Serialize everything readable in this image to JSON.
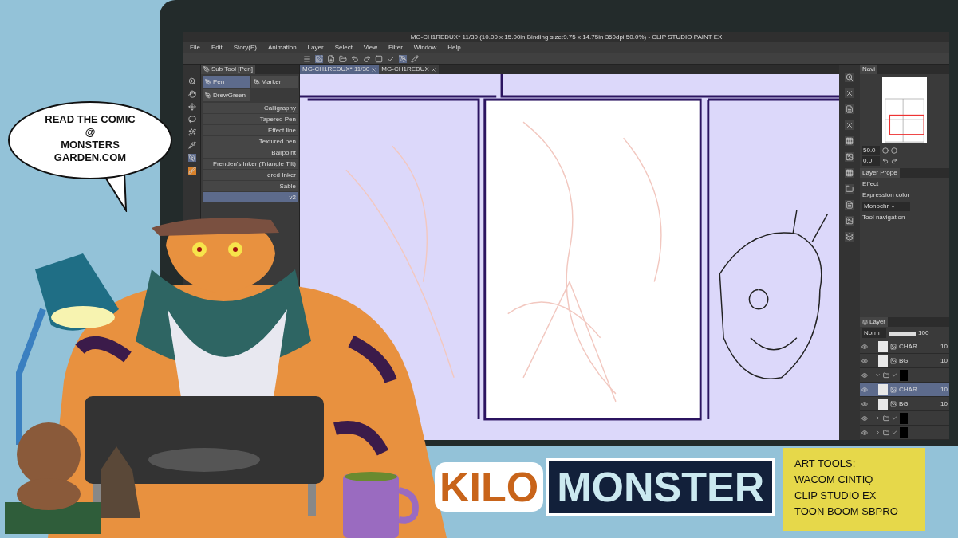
{
  "speech_bubble": {
    "lines": [
      "READ THE COMIC",
      "@",
      "MONSTERS",
      "GARDEN.COM"
    ]
  },
  "app": {
    "title": "MG-CH1REDUX* 11/30 (10.00 x 15.00in Binding size:9.75 x 14.75in 350dpi 50.0%)  - CLIP STUDIO PAINT EX",
    "menu": [
      "File",
      "Edit",
      "Story(P)",
      "Animation",
      "Layer",
      "Select",
      "View",
      "Filter",
      "Window",
      "Help"
    ],
    "doc_tabs": [
      {
        "label": "MG-CH1REDUX* 11/30",
        "selected": true
      },
      {
        "label": "MG-CH1REDUX",
        "selected": false
      }
    ],
    "sub_tool": {
      "tab": "Sub Tool [Pen]",
      "groups": [
        {
          "label": "Pen",
          "selected": true
        },
        {
          "label": "Marker",
          "selected": false
        },
        {
          "label": "DrewGreen",
          "selected": false
        }
      ],
      "brushes": [
        {
          "label": "Calligraphy",
          "selected": false
        },
        {
          "label": "Tapered Pen",
          "selected": false
        },
        {
          "label": "Effect line",
          "selected": false
        },
        {
          "label": "Textured pen",
          "selected": false
        },
        {
          "label": "Ballpoint",
          "selected": false
        },
        {
          "label": "Frenden's Inker (Triangle Tilt)",
          "selected": false
        },
        {
          "label": "ered Inker",
          "selected": false
        },
        {
          "label": "Sable",
          "selected": false
        },
        {
          "label": "v2",
          "selected": true
        }
      ]
    },
    "navigator": {
      "tab": "Navi",
      "zoom": "50.0",
      "rotation": "0.0"
    },
    "layer_property": {
      "tab": "Layer Prope",
      "effect": "Effect",
      "expression_color": "Expression color",
      "color_mode": "Monochr",
      "tool_navigation": "Tool navigation"
    },
    "layer_panel": {
      "tab": "Layer",
      "blend": "Norm",
      "opacity": "100",
      "opacity_slider": {
        "level": 1
      },
      "layers": [
        {
          "kind": "layer",
          "name": "CHAR",
          "opacity": "10",
          "selected": false
        },
        {
          "kind": "layer",
          "name": "BG",
          "opacity": "10",
          "selected": false
        },
        {
          "kind": "folder",
          "expanded": true,
          "selected": false
        },
        {
          "kind": "layer",
          "name": "CHAR",
          "opacity": "10",
          "selected": true
        },
        {
          "kind": "layer",
          "name": "BG",
          "opacity": "10",
          "selected": false
        },
        {
          "kind": "folder",
          "expanded": false,
          "selected": false
        },
        {
          "kind": "folder",
          "expanded": false,
          "selected": false
        }
      ]
    }
  },
  "logo": {
    "first": "KILO",
    "second": "MONSTER"
  },
  "sticky_note": {
    "lines": [
      "ART TOOLS:",
      "WACOM CINTIQ",
      "CLIP STUDIO EX",
      "TOON BOOM SBPRO"
    ]
  }
}
